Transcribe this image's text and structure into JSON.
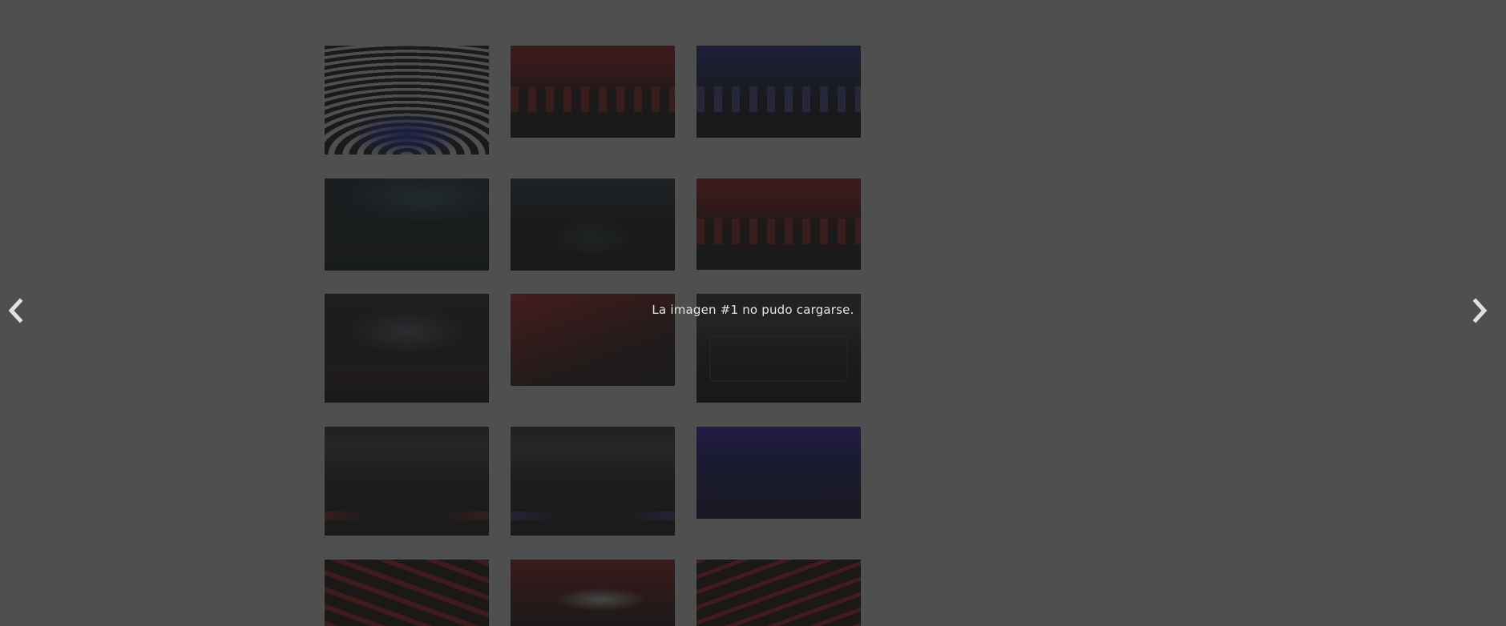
{
  "gallery": {
    "thumbnails": [
      {
        "name": "thumb-1",
        "art": "t-tunnel"
      },
      {
        "name": "thumb-2",
        "art": "t-red-dash"
      },
      {
        "name": "thumb-3",
        "art": "t-blue-dash"
      },
      {
        "name": "thumb-4",
        "art": "t-dark-teal"
      },
      {
        "name": "thumb-5",
        "art": "t-dark-room"
      },
      {
        "name": "thumb-6",
        "art": "t-red-dash"
      },
      {
        "name": "thumb-7",
        "art": "t-car-studio"
      },
      {
        "name": "thumb-8",
        "art": "t-red-seats"
      },
      {
        "name": "thumb-9",
        "art": "t-cockpit-dark"
      },
      {
        "name": "thumb-10",
        "art": "t-interior-grey"
      },
      {
        "name": "thumb-11",
        "art": "t-interior-grey-blue"
      },
      {
        "name": "thumb-12",
        "art": "t-blue-interior"
      },
      {
        "name": "thumb-13",
        "art": "t-red-tunnel"
      },
      {
        "name": "thumb-14",
        "art": "t-red-car"
      },
      {
        "name": "thumb-15",
        "art": "t-red-dark-car"
      }
    ]
  },
  "lightbox": {
    "error_message": "La imagen #1 no pudo cargarse.",
    "prev_icon": "chevron-left-icon",
    "next_icon": "chevron-right-icon",
    "overlay_color": "#1e1e1e"
  }
}
